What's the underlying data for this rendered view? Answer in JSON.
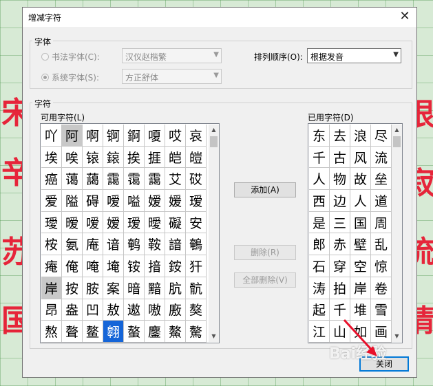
{
  "dialog": {
    "title": "增减字符",
    "close_glyph": "✕",
    "font_group": {
      "legend": "字体",
      "calligraphy_radio": "书法字体(C):",
      "calligraphy_value": "汉仪赵楷繁",
      "system_radio": "系统字体(S):",
      "system_value": "方正舒体",
      "sort_label": "排列顺序(O):",
      "sort_value": "根据发音"
    },
    "char_group": {
      "legend": "字符",
      "available_label": "可用字符(L)",
      "used_label": "已用字符(D)",
      "available_chars": [
        [
          "吖",
          "阿",
          "啊",
          "锕",
          "錒",
          "嗄",
          "哎",
          "哀"
        ],
        [
          "埃",
          "唉",
          "锿",
          "鎄",
          "挨",
          "捱",
          "皑",
          "皚"
        ],
        [
          "癌",
          "蔼",
          "藹",
          "靄",
          "霭",
          "靄",
          "艾",
          "砹"
        ],
        [
          "爱",
          "隘",
          "碍",
          "嗳",
          "嗌",
          "嫒",
          "媛",
          "瑷"
        ],
        [
          "璦",
          "暧",
          "嗳",
          "嫒",
          "瑷",
          "曖",
          "礙",
          "安"
        ],
        [
          "桉",
          "氨",
          "庵",
          "谙",
          "鹌",
          "鞍",
          "諳",
          "鵪"
        ],
        [
          "痷",
          "俺",
          "唵",
          "埯",
          "铵",
          "揞",
          "銨",
          "犴"
        ],
        [
          "岸",
          "按",
          "胺",
          "案",
          "暗",
          "黯",
          "肮",
          "骯"
        ],
        [
          "昂",
          "盎",
          "凹",
          "敖",
          "遨",
          "嗷",
          "廒",
          "獒"
        ],
        [
          "熬",
          "聱",
          "鳌",
          "翱",
          "螯",
          "鏖",
          "鰲",
          "驁"
        ]
      ],
      "used_chars": [
        [
          "东",
          "去",
          "浪",
          "尽"
        ],
        [
          "千",
          "古",
          "风",
          "流"
        ],
        [
          "人",
          "物",
          "故",
          "垒"
        ],
        [
          "西",
          "边",
          "人",
          "道"
        ],
        [
          "是",
          "三",
          "国",
          "周"
        ],
        [
          "郎",
          "赤",
          "壁",
          "乱"
        ],
        [
          "石",
          "穿",
          "空",
          "惊"
        ],
        [
          "涛",
          "拍",
          "岸",
          "卷"
        ],
        [
          "起",
          "千",
          "堆",
          "雪"
        ],
        [
          "江",
          "山",
          "如",
          "画"
        ]
      ],
      "add_button": "添加(A)",
      "remove_button": "删除(R)",
      "remove_all_button": "全部删除(V)"
    },
    "close_button": "关闭"
  },
  "background_chars": [
    "宋",
    "辛",
    "苏",
    "国",
    "恨",
    "寂",
    "流",
    "情"
  ],
  "watermark": "Bai经验"
}
